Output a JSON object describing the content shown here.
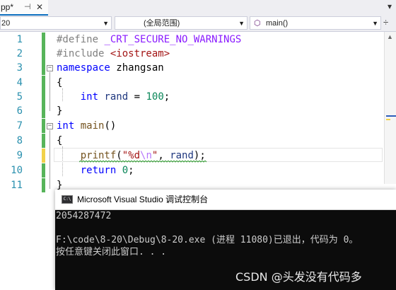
{
  "tab": {
    "name": "pp*",
    "pin_icon": "⊣",
    "close_icon": "✕",
    "overflow_icon": "▾"
  },
  "navbar": {
    "project_value": "20",
    "scope_value": "(全局范围)",
    "member_value": "main()",
    "member_icon": "cube-icon",
    "split_icon": "÷"
  },
  "editor": {
    "line_numbers": [
      "1",
      "2",
      "3",
      "4",
      "5",
      "6",
      "7",
      "8",
      "9",
      "10",
      "11"
    ],
    "lines": {
      "l1": {
        "pp": "#define ",
        "mac": "_CRT_SECURE_NO_WARNINGS"
      },
      "l2": {
        "pp": "#include ",
        "inc": "<iostream>"
      },
      "l3": {
        "kw": "namespace",
        "rest": " zhangsan"
      },
      "l4": {
        "text": "{"
      },
      "l5": {
        "kw": "int",
        "var": "rand",
        "eq": " = ",
        "num": "100",
        "end": ";"
      },
      "l6": {
        "text": "}"
      },
      "l7": {
        "kw": "int",
        "fn": "main",
        "end": "()"
      },
      "l8": {
        "text": "{"
      },
      "l9": {
        "fn": "printf",
        "open": "(",
        "str1": "\"%d",
        "esc": "\\n",
        "str2": "\"",
        "mid": ", ",
        "var": "rand",
        "end": ");"
      },
      "l10": {
        "kw": "return",
        "num": "0",
        "end": ";"
      },
      "l11": {
        "text": "}"
      }
    },
    "change_marks": [
      "green",
      "green",
      "green",
      "green",
      "green",
      "green",
      "green",
      "green",
      "yellow",
      "green",
      "green"
    ]
  },
  "console": {
    "title": "Microsoft Visual Studio 调试控制台",
    "icon": "console-app-icon",
    "output_lines": [
      "2054287472",
      "",
      "F:\\code\\8-20\\Debug\\8-20.exe (进程 11080)已退出，代码为 0。",
      "按任意键关闭此窗口. . ."
    ]
  },
  "watermark": "CSDN @头发没有代码多",
  "colors": {
    "keyword": "#0000ff",
    "macro": "#8a1bff",
    "string": "#a31515",
    "number": "#098658",
    "line_number": "#2b91af",
    "change_saved": "#57b45a",
    "change_unsaved": "#f2d24a",
    "accent": "#0e70c0"
  }
}
